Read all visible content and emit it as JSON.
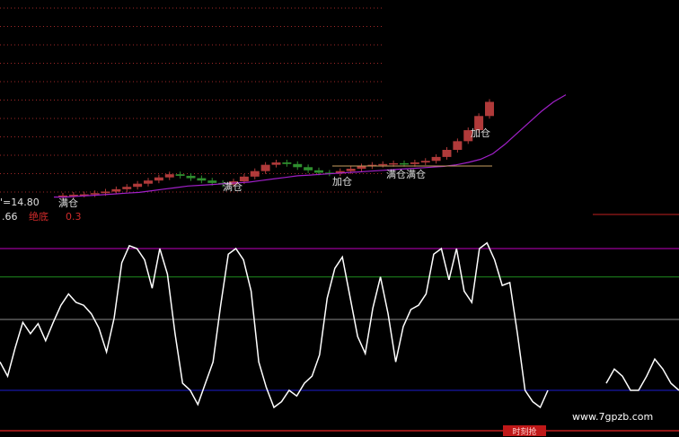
{
  "colors": {
    "background": "#000000",
    "grid": "#a02828",
    "candle_up": "#b03a3a",
    "candle_down": "#2f8f2f",
    "ma_line": "#a020c8",
    "support_line": "#c9a060",
    "oscillator": "#ffffff",
    "magenta_level": "#c000c0",
    "green_level": "#1e8a1e",
    "gray_level": "#8c8c8c",
    "blue_level": "#1c1cd0",
    "red_level": "#c02020",
    "label_text": "#e0e0e0"
  },
  "top_panel": {
    "price_label": "'=14.80",
    "value_label": ".66",
    "bottom_label": "绝底",
    "bottom_value": "0.3"
  },
  "annotations": [
    "满仓",
    "满仓",
    "加仓",
    "满仓满仓",
    "加仓"
  ],
  "footer": {
    "badge": "时刻抢",
    "watermark": "www.7gpzb.com"
  },
  "chart_data": [
    {
      "type": "candlestick",
      "series": [
        {
          "values": [
            [
              14.6,
              14.7
            ],
            [
              14.7,
              14.8
            ],
            [
              14.8,
              14.85
            ],
            [
              14.85,
              15.0
            ],
            [
              15.0,
              15.2
            ],
            [
              15.2,
              15.5
            ],
            [
              15.5,
              15.8
            ],
            [
              15.8,
              16.2
            ],
            [
              16.2,
              16.6
            ],
            [
              16.6,
              17.0
            ],
            [
              17.0,
              17.4
            ],
            [
              17.4,
              17.2
            ],
            [
              17.2,
              16.9
            ],
            [
              16.9,
              16.6
            ],
            [
              16.6,
              16.3
            ],
            [
              16.3,
              16.1
            ],
            [
              16.1,
              16.5
            ],
            [
              16.5,
              17.1
            ],
            [
              17.1,
              17.8
            ],
            [
              17.8,
              18.6
            ],
            [
              18.6,
              18.9
            ],
            [
              18.9,
              18.7
            ],
            [
              18.7,
              18.3
            ],
            [
              18.3,
              17.9
            ],
            [
              17.9,
              17.6
            ],
            [
              17.6,
              17.5
            ],
            [
              17.5,
              17.8
            ],
            [
              17.8,
              18.1
            ],
            [
              18.1,
              18.4
            ],
            [
              18.4,
              18.6
            ],
            [
              18.6,
              18.7
            ],
            [
              18.7,
              18.8
            ],
            [
              18.8,
              18.7
            ],
            [
              18.7,
              18.9
            ],
            [
              18.9,
              19.1
            ],
            [
              19.1,
              19.6
            ],
            [
              19.6,
              20.5
            ],
            [
              20.5,
              21.6
            ],
            [
              21.6,
              23.0
            ],
            [
              23.0,
              24.8
            ],
            [
              24.8,
              26.6
            ]
          ]
        },
        {
          "values": [
            14.5,
            14.5,
            14.6,
            14.7,
            14.8,
            14.9,
            15.0,
            15.1,
            15.3,
            15.5,
            15.7,
            15.9,
            16.0,
            16.1,
            16.2,
            16.3,
            16.4,
            16.6,
            16.8,
            17.0,
            17.2,
            17.3,
            17.4,
            17.5,
            17.6,
            17.7,
            17.8,
            17.9,
            18.0,
            18.1,
            18.2,
            18.3,
            18.4,
            18.6,
            18.9,
            19.3,
            20.0,
            21.2,
            22.6,
            24.0,
            25.4,
            26.6,
            27.5
          ]
        }
      ]
    },
    {
      "type": "line",
      "levels": [
        100,
        80,
        50,
        0
      ],
      "ylim": [
        -15,
        105
      ],
      "series": [
        {
          "values": [
            20,
            10,
            30,
            48,
            40,
            47,
            35,
            48,
            60,
            68,
            62,
            60,
            54,
            44,
            27,
            51,
            90,
            102,
            100,
            92,
            72,
            100,
            82,
            40,
            5,
            0,
            -10,
            5,
            20,
            60,
            96,
            100,
            92,
            70,
            20,
            2,
            -12,
            -8,
            0,
            -4,
            5,
            10,
            25,
            65,
            86,
            94,
            66,
            38,
            26,
            58,
            80,
            54,
            20,
            45,
            57,
            60,
            68,
            96,
            100,
            78,
            100,
            70,
            62,
            100,
            104,
            92,
            74,
            76,
            40,
            0,
            -8,
            -12,
            0
          ]
        },
        {
          "values": [
            5,
            15,
            10,
            0,
            0,
            10,
            22,
            15,
            5,
            0
          ]
        }
      ]
    }
  ]
}
